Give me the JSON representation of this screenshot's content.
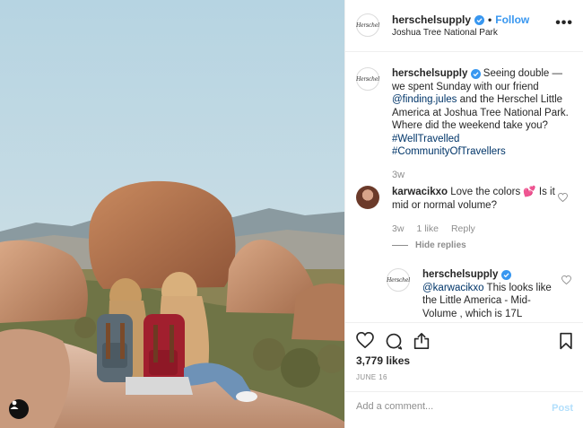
{
  "header": {
    "username": "herschelsupply",
    "separator": "•",
    "follow_label": "Follow",
    "location": "Joshua Tree National Park",
    "avatar_text": "Herschel",
    "more_icon": "more-horizontal-icon"
  },
  "caption": {
    "username": "herschelsupply",
    "text_1": "Seeing double — we spent Sunday with our friend ",
    "mention": "@finding.jules",
    "text_2": " and the Herschel Little America at Joshua Tree National Park. Where did the weekend take you? ",
    "hashtag_1": "#WellTravelled",
    "hashtag_2": "#CommunityOfTravellers",
    "age": "3w"
  },
  "comments": [
    {
      "username": "karwacikxo",
      "text": "Love the colors 💕 Is it mid or normal volume?",
      "age": "3w",
      "likes": "1 like",
      "reply_label": "Reply",
      "hide_replies_label": "Hide replies"
    }
  ],
  "reply": {
    "username": "herschelsupply",
    "mention": "@karwacikxo",
    "text": " This looks like the Little America - Mid-Volume , which is 17L"
  },
  "actions": {
    "likes": "3,779 likes",
    "date": "June 16",
    "comment_placeholder": "Add a comment...",
    "post_label": "Post"
  },
  "colors": {
    "link": "#003569",
    "accent": "#3897f0",
    "post_disabled": "#b2dffc",
    "muted": "#8e8e8e"
  }
}
